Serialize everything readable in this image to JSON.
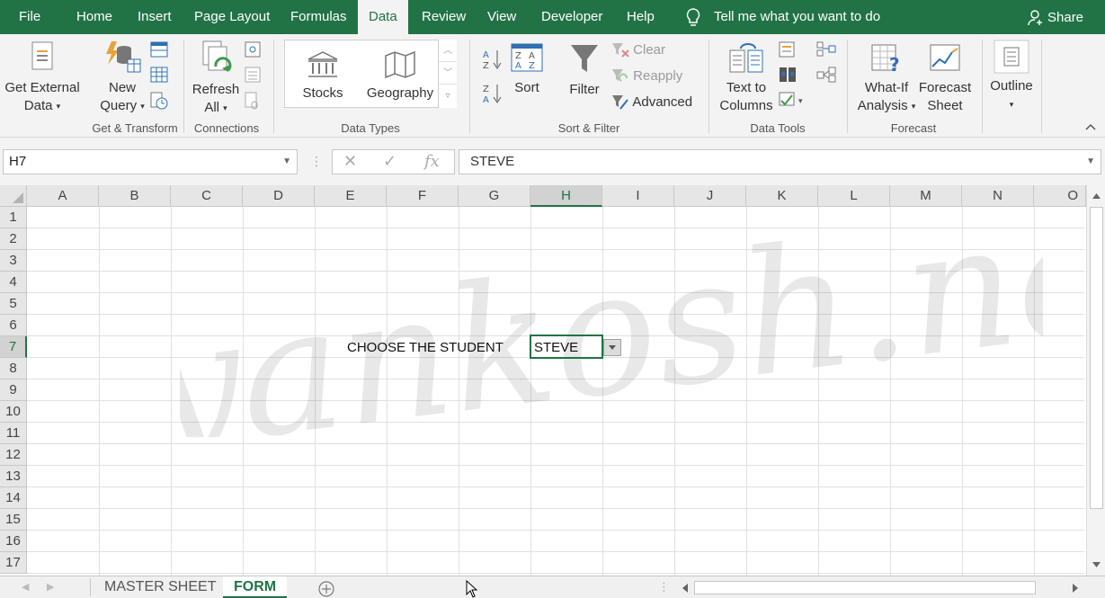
{
  "tabs": [
    "File",
    "Home",
    "Insert",
    "Page Layout",
    "Formulas",
    "Data",
    "Review",
    "View",
    "Developer",
    "Help"
  ],
  "active_tab": "Data",
  "tell_me": "Tell me what you want to do",
  "share": "Share",
  "ribbon": {
    "get_external_data": [
      "Get External",
      "Data"
    ],
    "new_query": [
      "New",
      "Query"
    ],
    "refresh_all": [
      "Refresh",
      "All"
    ],
    "stocks": "Stocks",
    "geography": "Geography",
    "sort": "Sort",
    "filter": "Filter",
    "clear": "Clear",
    "reapply": "Reapply",
    "advanced": "Advanced",
    "text_to_columns": [
      "Text to",
      "Columns"
    ],
    "what_if": [
      "What-If",
      "Analysis"
    ],
    "forecast_sheet": [
      "Forecast",
      "Sheet"
    ],
    "outline": "Outline",
    "groups": {
      "get_transform": "Get & Transform",
      "connections": "Connections",
      "data_types": "Data Types",
      "sort_filter": "Sort & Filter",
      "data_tools": "Data Tools",
      "forecast": "Forecast"
    }
  },
  "formula_bar": {
    "name_box": "H7",
    "formula": "STEVE"
  },
  "grid": {
    "columns": [
      "A",
      "B",
      "C",
      "D",
      "E",
      "F",
      "G",
      "H",
      "I",
      "J",
      "K",
      "L",
      "M",
      "N",
      "O"
    ],
    "rows": [
      "1",
      "2",
      "3",
      "4",
      "5",
      "6",
      "7",
      "8",
      "9",
      "10",
      "11",
      "12",
      "13",
      "14",
      "15",
      "16",
      "17"
    ],
    "selected_column": "H",
    "selected_row": "7",
    "cells": {
      "E7": "CHOOSE THE STUDENT",
      "H7": "STEVE"
    },
    "watermark": "gyankosh.net"
  },
  "sheets": [
    "MASTER SHEET",
    "FORM"
  ],
  "active_sheet": "FORM",
  "colors": {
    "accent": "#217346"
  }
}
